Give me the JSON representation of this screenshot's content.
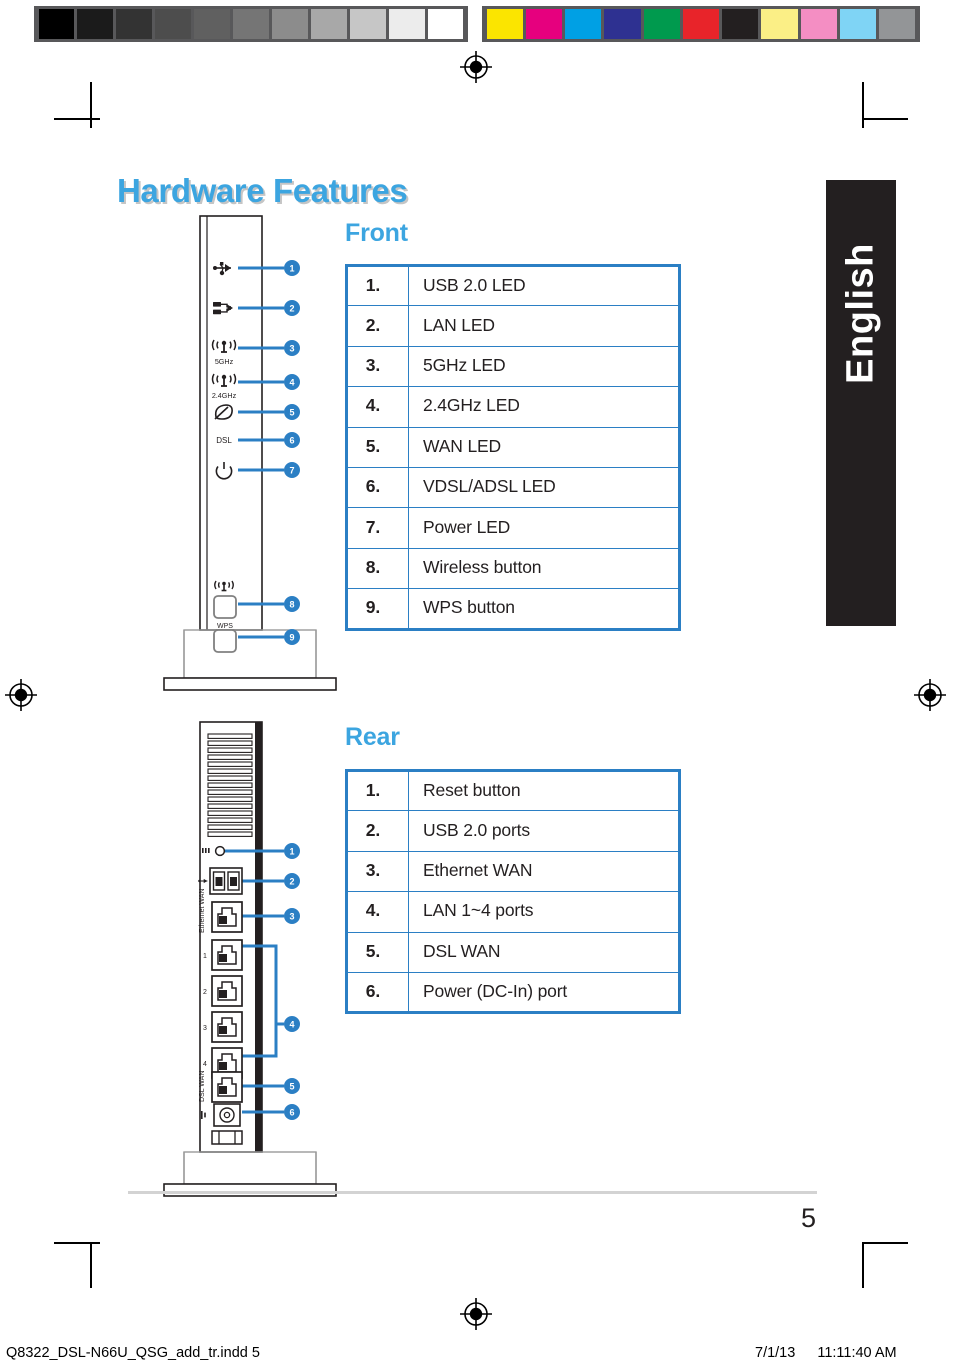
{
  "page": {
    "title": "Hardware Features",
    "language_tab": "English",
    "page_number": "5"
  },
  "calibration_bar": {
    "grayscale": [
      "#000000",
      "#1b1b1b",
      "#333333",
      "#4d4d4d",
      "#606060",
      "#757575",
      "#8c8c8c",
      "#a8a8a8",
      "#c6c6c6",
      "#ececec",
      "#ffffff"
    ],
    "colors": [
      "#fbe500",
      "#e6007e",
      "#00a0e4",
      "#2e3191",
      "#009a4e",
      "#e8242a",
      "#231f20",
      "#fbef86",
      "#f48ec3",
      "#7fd4f5",
      "#939597"
    ],
    "background": "#58585a"
  },
  "sections": [
    {
      "heading": "Front",
      "table": {
        "rows": [
          {
            "num": "1.",
            "label": "USB 2.0 LED"
          },
          {
            "num": "2.",
            "label": "LAN LED"
          },
          {
            "num": "3.",
            "label": "5GHz LED"
          },
          {
            "num": "4.",
            "label": "2.4GHz LED"
          },
          {
            "num": "5.",
            "label": "WAN LED"
          },
          {
            "num": "6.",
            "label": "VDSL/ADSL LED"
          },
          {
            "num": "7.",
            "label": "Power LED"
          },
          {
            "num": "8.",
            "label": "Wireless button"
          },
          {
            "num": "9.",
            "label": "WPS button"
          }
        ]
      },
      "illustration": {
        "callouts": [
          "1",
          "2",
          "3",
          "4",
          "5",
          "6",
          "7",
          "8",
          "9"
        ],
        "panel_labels": [
          "5GHz",
          "2.4GHz",
          "DSL",
          "WPS"
        ],
        "icons": [
          "usb-icon",
          "lan-icon",
          "wifi-5ghz-icon",
          "wifi-24ghz-icon",
          "wan-globe-icon",
          "dsl-text-label",
          "power-icon",
          "wireless-antenna-icon"
        ]
      }
    },
    {
      "heading": "Rear",
      "table": {
        "rows": [
          {
            "num": "1.",
            "label": "Reset button"
          },
          {
            "num": "2.",
            "label": "USB 2.0 ports"
          },
          {
            "num": "3.",
            "label": "Ethernet WAN"
          },
          {
            "num": "4.",
            "label": "LAN 1~4 ports"
          },
          {
            "num": "5.",
            "label": "DSL WAN"
          },
          {
            "num": "6.",
            "label": "Power (DC-In) port"
          }
        ]
      },
      "illustration": {
        "callouts": [
          "1",
          "2",
          "3",
          "4",
          "5",
          "6"
        ],
        "panel_labels": [
          "Ethernet WAN",
          "DSL WAN"
        ],
        "icons": [
          "reset-icon",
          "usb-icon",
          "ethernet-port-icon",
          "lan-port-icon",
          "dsl-port-icon",
          "power-jack-icon"
        ]
      }
    }
  ],
  "footer": {
    "filename": "Q8322_DSL-N66U_QSG_add_tr.indd   5",
    "date": "7/1/13",
    "time": "11:11:40 AM"
  },
  "theme": {
    "accent_blue": "#3ca5e0",
    "table_blue": "#2b7fc4",
    "callout_blue": "#2b7fc4",
    "ink": "#231f20"
  }
}
